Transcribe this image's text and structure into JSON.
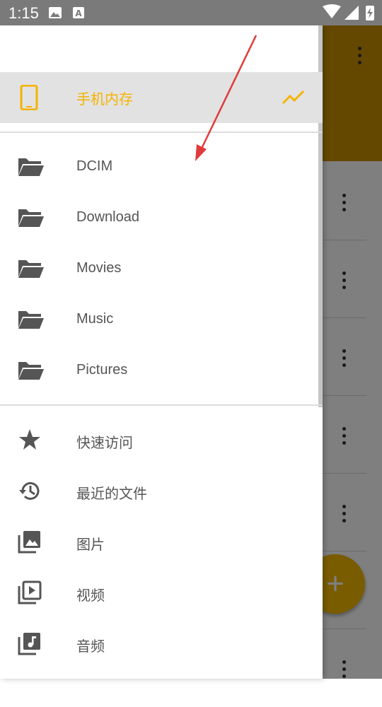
{
  "status_bar": {
    "time": "1:15"
  },
  "drawer": {
    "storage": {
      "label": "手机内存",
      "icon": "phone-icon",
      "trend_icon": "trend-icon",
      "accent_color": "#f5b300"
    },
    "folders": [
      {
        "label": "DCIM",
        "icon": "folder-open-icon"
      },
      {
        "label": "Download",
        "icon": "folder-open-icon"
      },
      {
        "label": "Movies",
        "icon": "folder-open-icon"
      },
      {
        "label": "Music",
        "icon": "folder-open-icon"
      },
      {
        "label": "Pictures",
        "icon": "folder-open-icon"
      }
    ],
    "nav": [
      {
        "label": "快速访问",
        "icon": "star-icon"
      },
      {
        "label": "最近的文件",
        "icon": "history-icon"
      },
      {
        "label": "图片",
        "icon": "image-library-icon"
      },
      {
        "label": "视频",
        "icon": "video-library-icon"
      },
      {
        "label": "音频",
        "icon": "music-library-icon"
      }
    ]
  },
  "background_app": {
    "toolbar_color": "#c99000",
    "fab_icon": "plus-icon"
  }
}
